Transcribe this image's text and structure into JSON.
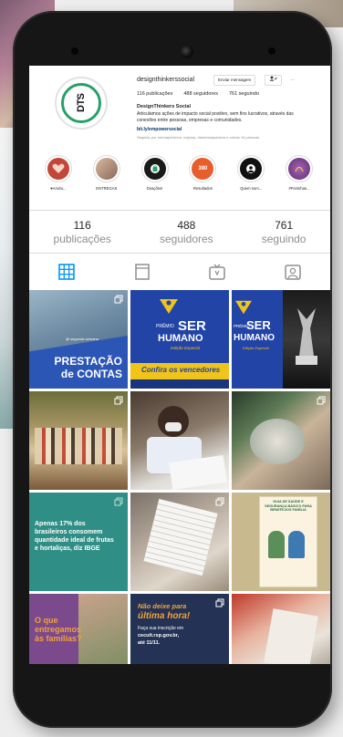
{
  "profile": {
    "username": "designthinkerssocial",
    "avatar_text": "DTS",
    "buttons": {
      "message": "Enviar mensagem",
      "follow": "Seguindo",
      "options": "..."
    },
    "stats_inline": {
      "posts": "116 publicações",
      "followers": "488 seguidores",
      "following": "761 seguindo"
    },
    "bio_name": "DesignThinkers Social",
    "bio_text": "Articulamos ações de impacto social positivo, sem fins lucrativos, através das conexões entre pessoas, empresas e comunidades.",
    "bio_link": "bit.ly/empowersocial",
    "followed_by": "Seguido por hermapeixinho, udyana, danubiampadova e outras 16 pessoas"
  },
  "highlights": [
    {
      "label": "♥Amizu...",
      "color": "#c2473a",
      "icon": "heart-hands-icon"
    },
    {
      "label": "ENTREGAS",
      "color": "#b98f73",
      "icon": "photo-icon"
    },
    {
      "label": "Doações!",
      "color": "#1a1a1a",
      "icon": "bag-icon"
    },
    {
      "label": "Resultados",
      "color": "#e85d2c",
      "icon": "number-icon"
    },
    {
      "label": "Quem som...",
      "color": "#111111",
      "icon": "people-icon"
    },
    {
      "label": "#Feirinhas...",
      "color": "#7b3f8b",
      "icon": "fair-icon"
    }
  ],
  "counts": [
    {
      "number": "116",
      "label": "publicações"
    },
    {
      "number": "488",
      "label": "seguidores"
    },
    {
      "number": "761",
      "label": "seguindo"
    }
  ],
  "tabs": [
    {
      "name": "tab-posts-grid",
      "icon": "grid-icon",
      "active": true
    },
    {
      "name": "tab-feed",
      "icon": "feed-icon",
      "active": false
    },
    {
      "name": "tab-igtv",
      "icon": "tv-icon",
      "active": false
    },
    {
      "name": "tab-tagged",
      "icon": "tagged-icon",
      "active": false
    }
  ],
  "posts": {
    "p1": {
      "title_line1": "PRESTAÇÃO",
      "title_line2": "de CONTAS",
      "small": "@ segunda semana"
    },
    "p2": {
      "line1": "PRÊMIO",
      "line2": "SER",
      "line3": "HUMANO",
      "line4": "Edição Especial",
      "banner": "Confira os vencedores"
    },
    "p3": {
      "line1": "PRÊMIO",
      "line2": "SER",
      "line3": "HUMANO",
      "line4": "Edição Especial"
    },
    "p7": {
      "text": "Apenas 17% dos brasileiros consomem quantidade ideal de frutas e hortaliças, diz IBGE"
    },
    "p9": {
      "text": "GUIA DE SAÚDE E SEGURANÇA BÁSICO PARA BENEFÍCIOS FAMÍLIA"
    },
    "p10": {
      "text": "O que entregamos às famílias?"
    },
    "p11": {
      "line1": "Não deixe para",
      "line2": "última hora!",
      "small1": "Faça sua inscrição em",
      "small2": "cecult.rsp.gov.br,",
      "small3": "até 11/11."
    }
  },
  "colors": {
    "brand_green": "#27a06a",
    "ig_blue": "#0095f6",
    "post_blue": "#1f3e9e",
    "post_yellow": "#f0c419",
    "post_teal": "#2f8f86",
    "post_purple": "#7a4a8c",
    "post_navy": "#243355",
    "post_orange": "#f2a13b"
  }
}
